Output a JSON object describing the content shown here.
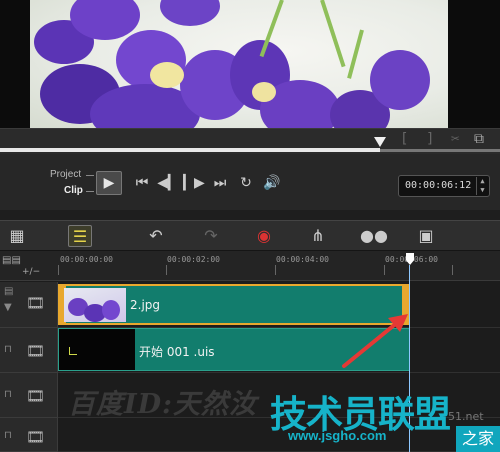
{
  "preview": {
    "image_subject": "purple-violet-flowers"
  },
  "scrubber": {
    "position": 0.76
  },
  "transport": {
    "project_label": "Project",
    "clip_label": "Clip",
    "timecode": "00:00:06:12"
  },
  "toolbar": {
    "icons": [
      "storyboard-view-icon",
      "timeline-view-icon",
      "undo-icon",
      "redo-icon",
      "record-capture-icon",
      "audio-mixer-icon",
      "auto-music-icon",
      "title-icon"
    ]
  },
  "ruler": {
    "labels": [
      "00:00:00:00",
      "00:00:02:00",
      "00:00:04:00",
      "00:00:06:00"
    ]
  },
  "tracks": {
    "clip1": {
      "name": "2.jpg"
    },
    "clip2": {
      "name": "开始 001 .uis"
    }
  },
  "watermarks": {
    "baidu_id": "百度ID:天然汝",
    "site_logo": "技术员联盟",
    "site_tail": "51.net",
    "site_url": "www.jsgho.com",
    "site_corner": "之家"
  },
  "colors": {
    "clip_green": "#127d6d",
    "clip_selected_border": "#e8a82e",
    "arrow_red": "#e53935",
    "watermark_cyan": "#16b3c9"
  }
}
